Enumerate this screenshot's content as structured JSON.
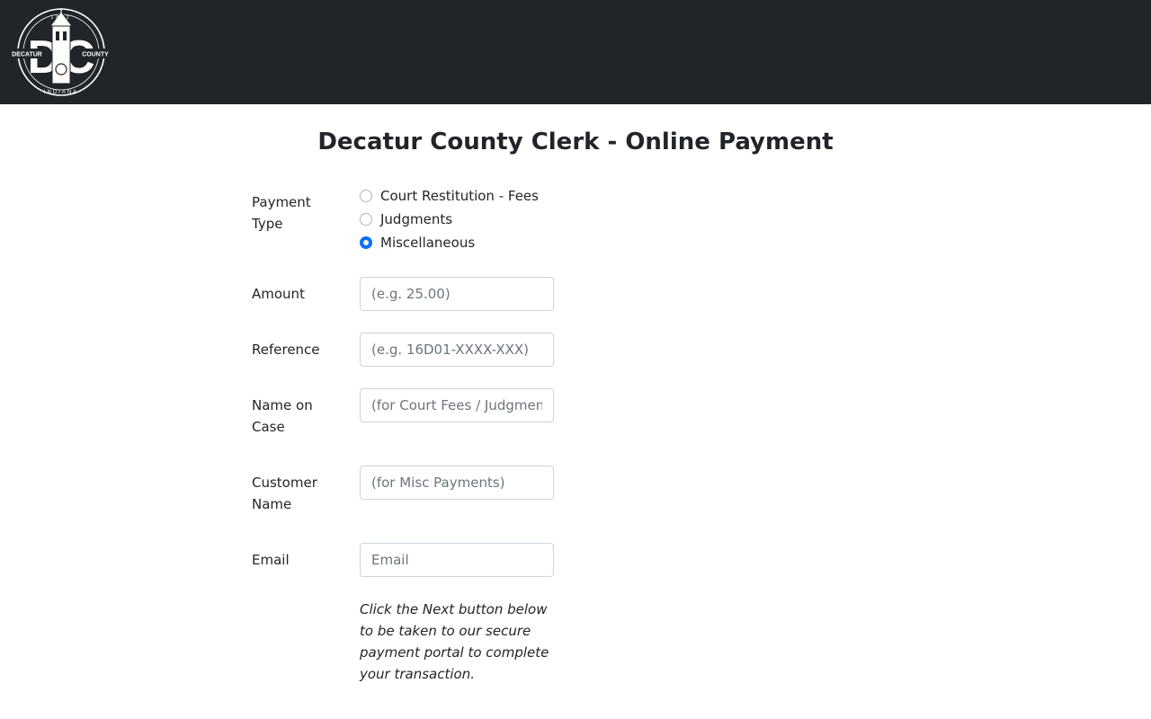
{
  "header": {
    "logo_letters": "DC",
    "logo_left_text": "DECATUR",
    "logo_right_text": "COUNTY",
    "logo_bottom_text": "INDIANA",
    "logo_year": "1822"
  },
  "page_title": "Decatur County Clerk - Online Payment",
  "form": {
    "payment_type": {
      "label": "Payment Type",
      "options": [
        "Court Restitution - Fees",
        "Judgments",
        "Miscellaneous"
      ],
      "selected": "Miscellaneous"
    },
    "amount": {
      "label": "Amount",
      "placeholder": "(e.g. 25.00)",
      "value": ""
    },
    "reference": {
      "label": "Reference",
      "placeholder": "(e.g. 16D01-XXXX-XXX)",
      "value": ""
    },
    "name_on_case": {
      "label": "Name on Case",
      "placeholder": "(for Court Fees / Judgments)",
      "value": ""
    },
    "customer_name": {
      "label": "Customer Name",
      "placeholder": "(for Misc Payments)",
      "value": ""
    },
    "email": {
      "label": "Email",
      "placeholder": "Email",
      "value": ""
    },
    "note": "Click the Next button below to be taken to our secure payment portal to complete your transaction."
  },
  "colors": {
    "navbar": "#212529",
    "accent": "#0d6efd",
    "text": "#212529"
  }
}
